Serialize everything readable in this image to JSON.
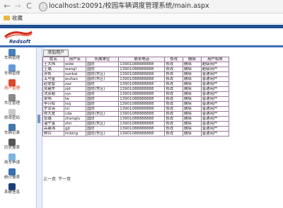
{
  "browser": {
    "back": "←",
    "forward": "→",
    "reload": "C",
    "lock": "ⓘ",
    "url": "localhost:20091/校园车辆调度管理系统/main.aspx",
    "bookmark_folder": "收藏"
  },
  "logo": {
    "text": "Redsoft"
  },
  "sidebar": {
    "items": [
      {
        "label": "车辆管理",
        "color": "#4a7fc1"
      },
      {
        "label": "车辆管理",
        "color": "#6a9ad6"
      },
      {
        "label": "用户管理",
        "color": "#d94a2a"
      },
      {
        "label": "车位管理",
        "color": "#8a8a8a"
      },
      {
        "label": "修改密码",
        "color": "#c9c9c9"
      },
      {
        "label": "车辆记录",
        "color": "#4477aa"
      },
      {
        "label": "历史报表",
        "color": "#555555"
      },
      {
        "label": "用车申请",
        "color": "#7fb3e0"
      },
      {
        "label": "统计报表",
        "color": "#3a6fb0"
      },
      {
        "label": "系统信息",
        "color": "#1b3f7a"
      }
    ]
  },
  "main": {
    "add_label": "添加用户",
    "columns": [
      "姓名",
      "用户名",
      "所属单位",
      "联系电话",
      "修改",
      "删除",
      "用户权限"
    ],
    "rows": [
      [
        "王大伟",
        "wdw",
        "国防",
        "13901088888888",
        "修改",
        "删除",
        "超级用户"
      ],
      [
        "王璐",
        "wangl",
        "国防",
        "13901088888888",
        "修改",
        "删除",
        "超级用户"
      ],
      [
        "孙凯",
        "sunkai",
        "国防(东区)",
        "13901088888888",
        "修改",
        "删除",
        "普通用户"
      ],
      [
        "五号星",
        "wuhao",
        "国防(东区)",
        "13901088888888",
        "修改",
        "删除",
        "普通用户"
      ],
      [
        "赵爱智",
        "zaz",
        "国防",
        "13901088888888",
        "修改",
        "删除",
        "普通用户"
      ],
      [
        "张建东",
        "zjd",
        "国防(东区)",
        "13901088888888",
        "修改",
        "删除",
        "普通用户"
      ],
      [
        "沈彦超",
        "syc",
        "国防",
        "13901088888888",
        "修改",
        "删除",
        "普通用户"
      ],
      [
        "梁伟",
        "lw",
        "国防",
        "13901088888888",
        "修改",
        "删除",
        "普通用户"
      ],
      [
        "李兴权",
        "lxq",
        "国防",
        "13901088888888",
        "修改",
        "删除",
        "普通用户"
      ],
      [
        "罗幸亮",
        "lxl",
        "国防",
        "13901088888888",
        "修改",
        "删除",
        "普通用户"
      ],
      [
        "陈大爱",
        "cda",
        "国防(东区)",
        "13901088888888",
        "修改",
        "删除",
        "普通用户"
      ],
      [
        "张璐",
        "zhanglu",
        "国防",
        "13901088888888",
        "修改",
        "删除",
        "普通用户"
      ],
      [
        "诸宁金",
        "zhn",
        "国防(东区)",
        "13901088888888",
        "修改",
        "删除",
        "普通用户"
      ],
      [
        "高建涛",
        "gjt",
        "国防",
        "13901088888888",
        "修改",
        "删除",
        "普通用户"
      ],
      [
        "林兵",
        "linbing",
        "国防(东区)",
        "13901088888888",
        "修改",
        "删除",
        "普通用户"
      ]
    ],
    "pager": {
      "prev": "上一页",
      "next": "下一页"
    }
  }
}
